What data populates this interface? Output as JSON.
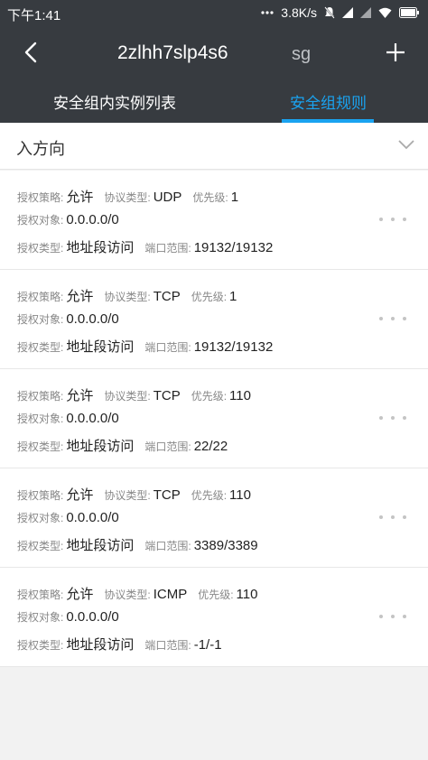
{
  "status_bar": {
    "time": "下午1:41",
    "network_speed": "3.8K/s"
  },
  "app_bar": {
    "title": "2zlhh7slp4s6",
    "title_tail": "sg"
  },
  "tabs": [
    {
      "label": "安全组内实例列表",
      "active": false
    },
    {
      "label": "安全组规则",
      "active": true
    }
  ],
  "accent_color": "#1aa3f0",
  "section": {
    "title": "入方向"
  },
  "labels": {
    "policy": "授权策略:",
    "protocol": "协议类型:",
    "priority": "优先级:",
    "object": "授权对象:",
    "auth_type": "授权类型:",
    "port_range": "端口范围:"
  },
  "rules": [
    {
      "policy": "允许",
      "protocol": "UDP",
      "priority": "1",
      "object": "0.0.0.0/0",
      "auth_type": "地址段访问",
      "port_range": "19132/19132"
    },
    {
      "policy": "允许",
      "protocol": "TCP",
      "priority": "1",
      "object": "0.0.0.0/0",
      "auth_type": "地址段访问",
      "port_range": "19132/19132"
    },
    {
      "policy": "允许",
      "protocol": "TCP",
      "priority": "110",
      "object": "0.0.0.0/0",
      "auth_type": "地址段访问",
      "port_range": "22/22"
    },
    {
      "policy": "允许",
      "protocol": "TCP",
      "priority": "110",
      "object": "0.0.0.0/0",
      "auth_type": "地址段访问",
      "port_range": "3389/3389"
    },
    {
      "policy": "允许",
      "protocol": "ICMP",
      "priority": "110",
      "object": "0.0.0.0/0",
      "auth_type": "地址段访问",
      "port_range": "-1/-1"
    }
  ]
}
